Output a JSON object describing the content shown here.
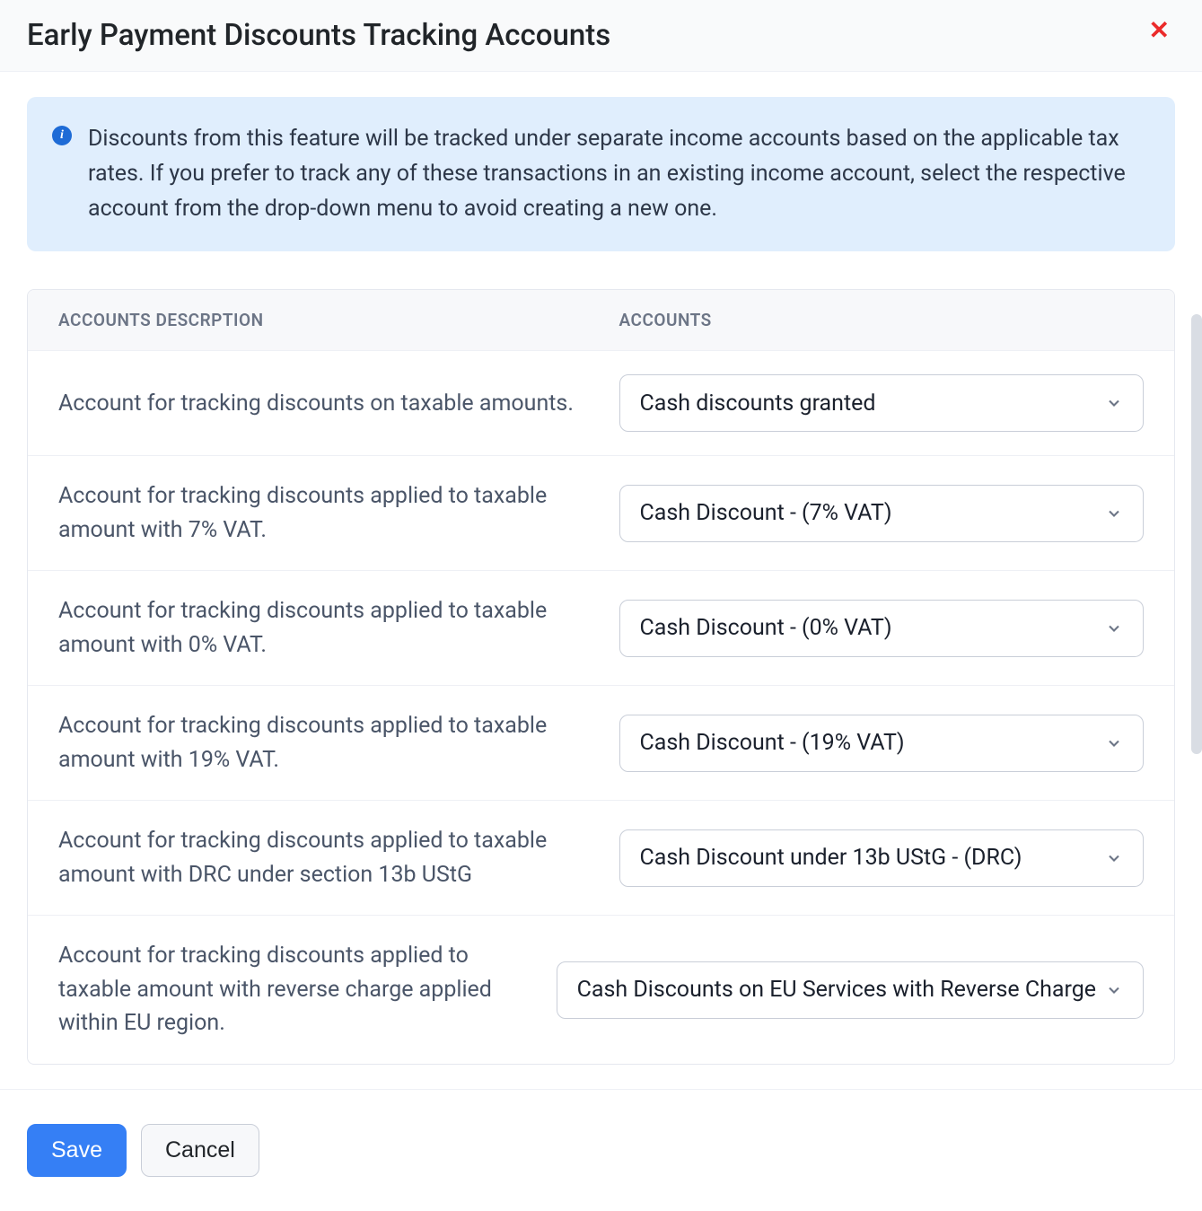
{
  "header": {
    "title": "Early Payment Discounts Tracking Accounts"
  },
  "info": {
    "text": "Discounts from this feature will be tracked under separate income accounts based on the applicable tax rates. If you prefer to track any of these transactions in an existing income account, select the respective account from the drop-down menu to avoid creating a new one."
  },
  "table": {
    "headers": {
      "desc": "ACCOUNTS DESCRPTION",
      "acct": "ACCOUNTS"
    },
    "rows": [
      {
        "desc": "Account for tracking discounts on taxable amounts.",
        "value": "Cash discounts granted"
      },
      {
        "desc": "Account for tracking discounts applied to taxable amount with 7% VAT.",
        "value": "Cash Discount - (7% VAT)"
      },
      {
        "desc": "Account for tracking discounts applied to taxable amount with 0% VAT.",
        "value": "Cash Discount - (0% VAT)"
      },
      {
        "desc": "Account for tracking discounts applied to taxable amount with 19% VAT.",
        "value": "Cash Discount - (19% VAT)"
      },
      {
        "desc": "Account for tracking discounts applied to taxable amount with DRC under section 13b UStG",
        "value": "Cash Discount under 13b UStG - (DRC)"
      },
      {
        "desc": "Account for tracking discounts applied to taxable amount with reverse charge applied within EU region.",
        "value": "Cash Discounts on EU Services with Reverse Charge"
      }
    ]
  },
  "footer": {
    "save": "Save",
    "cancel": "Cancel"
  }
}
